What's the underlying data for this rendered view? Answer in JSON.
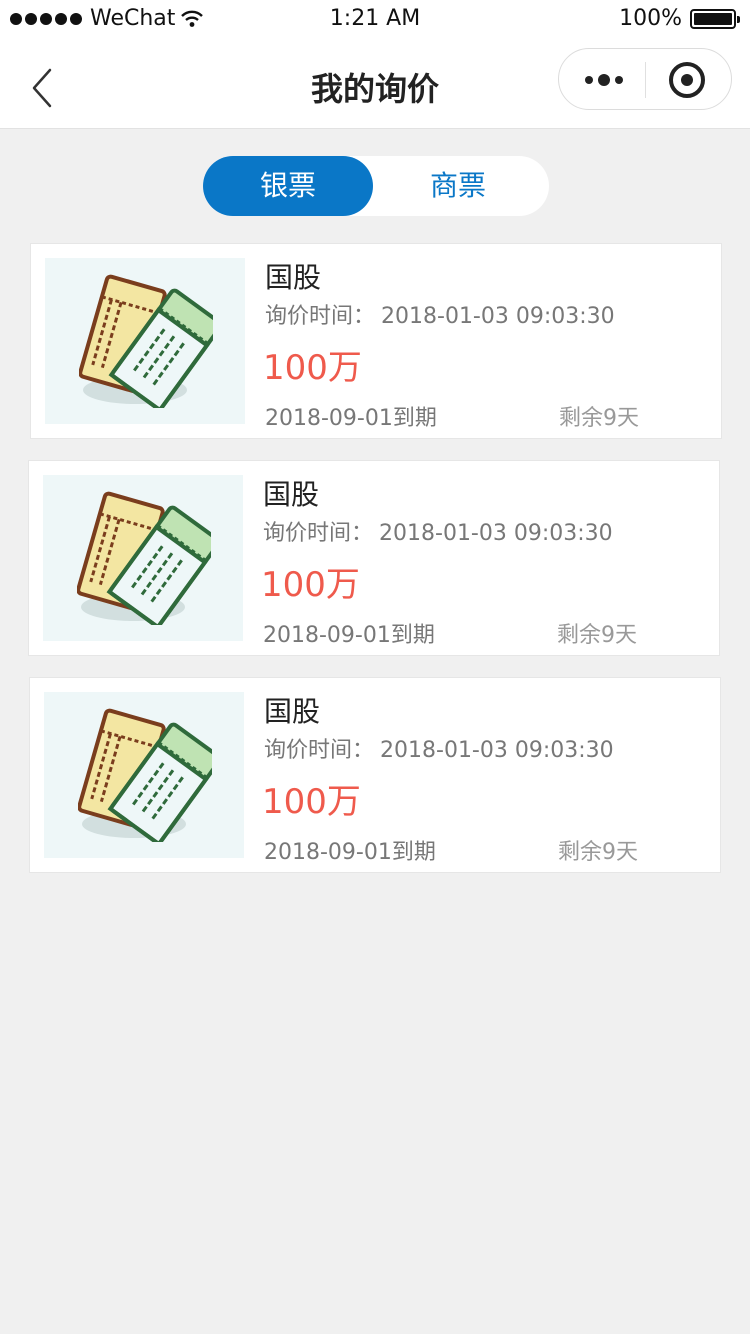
{
  "status_bar": {
    "carrier": "WeChat",
    "time": "1:21 AM",
    "battery": "100%"
  },
  "nav": {
    "title": "我的询价"
  },
  "tabs": [
    {
      "label": "银票",
      "active": true
    },
    {
      "label": "商票",
      "active": false
    }
  ],
  "colors": {
    "accent": "#0a77c7",
    "amount": "#ef5a4c"
  },
  "cards": [
    {
      "name": "国股",
      "time_label": "询价时间：",
      "time_value": "2018-01-03   09:03:30",
      "amount": "100万",
      "due": "2018-09-01到期",
      "remaining": "剩余9天",
      "icon": "ticket-icon"
    },
    {
      "name": "国股",
      "time_label": "询价时间：",
      "time_value": "2018-01-03   09:03:30",
      "amount": "100万",
      "due": "2018-09-01到期",
      "remaining": "剩余9天",
      "icon": "ticket-icon"
    },
    {
      "name": "国股",
      "time_label": "询价时间：",
      "time_value": "2018-01-03   09:03:30",
      "amount": "100万",
      "due": "2018-09-01到期",
      "remaining": "剩余9天",
      "icon": "ticket-icon"
    }
  ]
}
